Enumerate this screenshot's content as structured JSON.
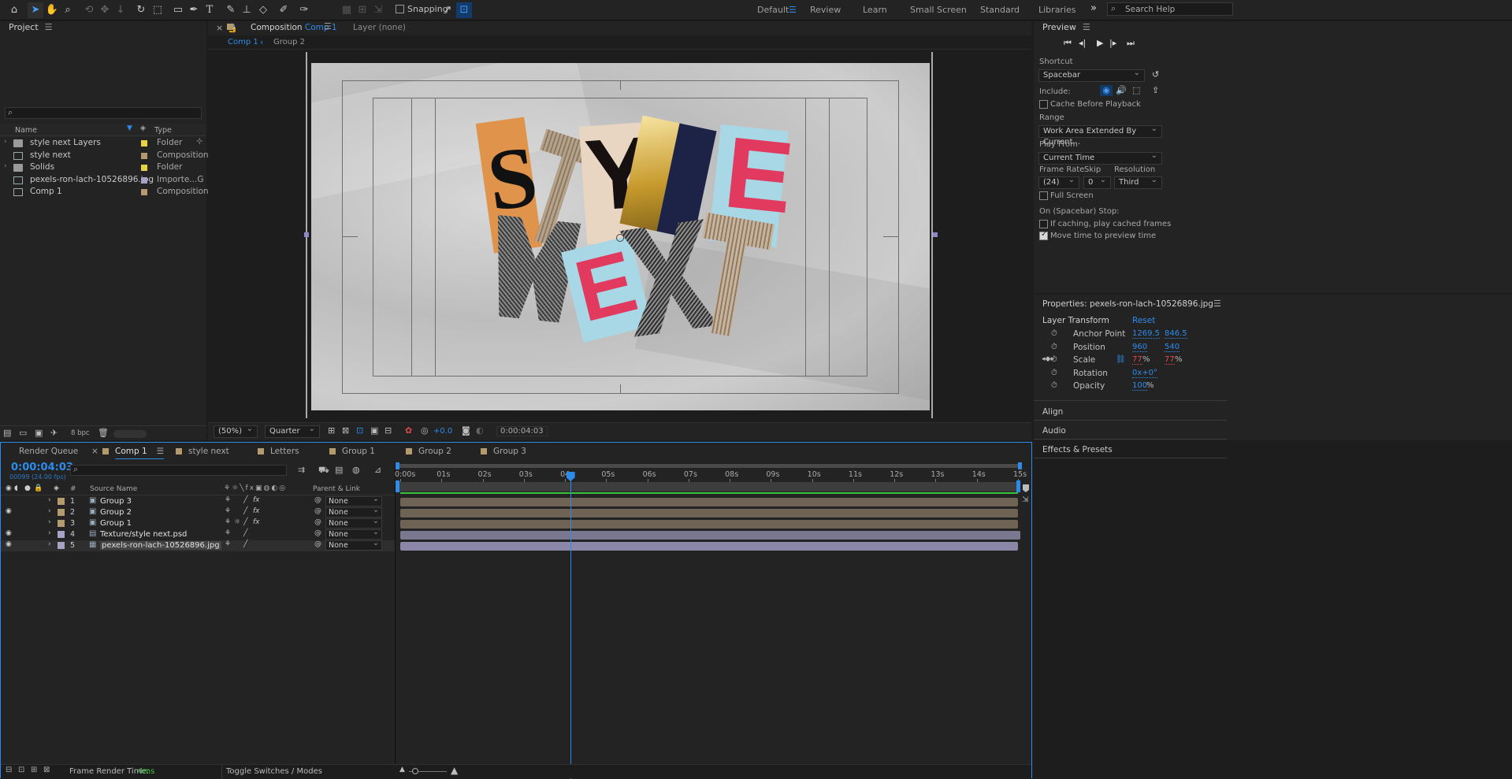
{
  "toolbar": {
    "snapping_label": "Snapping",
    "workspaces": [
      "Default",
      "Review",
      "Learn",
      "Small Screen",
      "Standard",
      "Libraries"
    ],
    "active_workspace": "Default",
    "overflow_icon": "chevrons-right-icon",
    "search_placeholder": "Search Help"
  },
  "project": {
    "title": "Project",
    "columns": {
      "name": "Name",
      "type": "Type"
    },
    "items": [
      {
        "name": "style next Layers",
        "type": "Folder",
        "color": "#e8d440",
        "icon": "folder-icon"
      },
      {
        "name": "style next",
        "type": "Composition",
        "color": "#b59a6e",
        "icon": "folder-icon"
      },
      {
        "name": "Solids",
        "type": "Folder",
        "color": "#e8d440",
        "icon": "folder-icon"
      },
      {
        "name": "pexels-ron-lach-10526896.jpg",
        "type": "Importe...G",
        "color": "#a6a2c6",
        "icon": "image-file-icon"
      },
      {
        "name": "Comp 1",
        "type": "Composition",
        "color": "#b59a6e",
        "icon": "composition-icon"
      }
    ],
    "bpc": "8 bpc"
  },
  "composition": {
    "tab_prefix": "Composition",
    "tab_name": "Comp 1",
    "layer_label": "Layer (none)",
    "breadcrumbs": [
      "Comp 1",
      "Group 2"
    ],
    "zoom": "(50%)",
    "resolution": "Quarter",
    "exposure": "+0.0",
    "timecode": "0:00:04:03"
  },
  "preview": {
    "title": "Preview",
    "shortcut_label": "Shortcut",
    "shortcut_value": "Spacebar",
    "include_label": "Include:",
    "cache_before_playback": "Cache Before Playback",
    "range_label": "Range",
    "range_value": "Work Area Extended By Current...",
    "play_from_label": "Play From",
    "play_from_value": "Current Time",
    "frame_rate_label": "Frame Rate",
    "skip_label": "Skip",
    "resolution_label": "Resolution",
    "frame_rate_value": "(24)",
    "skip_value": "0",
    "resolution_value": "Third",
    "full_screen": "Full Screen",
    "stop_label": "On (Spacebar) Stop:",
    "if_caching": "If caching, play cached frames",
    "move_time": "Move time to preview time"
  },
  "properties": {
    "title": "Properties: pexels-ron-lach-10526896.jpg",
    "section": "Layer Transform",
    "reset": "Reset",
    "rows": [
      {
        "label": "Anchor Point",
        "v1": "1269.5",
        "v2": "846.5"
      },
      {
        "label": "Position",
        "v1": "960",
        "v2": "540"
      },
      {
        "label": "Scale",
        "v1": "77",
        "v2": "77",
        "unit": "%"
      },
      {
        "label": "Rotation",
        "v1": "0x+0°"
      },
      {
        "label": "Opacity",
        "v1": "100",
        "unit": "%"
      }
    ],
    "sections": [
      "Align",
      "Audio",
      "Effects & Presets"
    ]
  },
  "timeline": {
    "tabs": [
      {
        "label": "Render Queue",
        "color": ""
      },
      {
        "label": "Comp 1",
        "color": "#b59a6e"
      },
      {
        "label": "style next",
        "color": "#b59a6e"
      },
      {
        "label": "Letters",
        "color": "#b59a6e"
      },
      {
        "label": "Group 1",
        "color": "#b59a6e"
      },
      {
        "label": "Group 2",
        "color": "#b59a6e"
      },
      {
        "label": "Group 3",
        "color": "#b59a6e"
      }
    ],
    "timecode": "0:00:04:03",
    "frame_info": "00099 (24.00 fps)",
    "col_source": "Source Name",
    "col_num": "#",
    "col_parent": "Parent & Link",
    "ruler": [
      "0:00s",
      "01s",
      "02s",
      "03s",
      "04s",
      "05s",
      "06s",
      "07s",
      "08s",
      "09s",
      "10s",
      "11s",
      "12s",
      "13s",
      "14s",
      "15s"
    ],
    "playhead_seconds": 4.125,
    "layers": [
      {
        "num": "1",
        "name": "Group 3",
        "color": "#b59a6e",
        "parent": "None",
        "type": "comp",
        "fx": true
      },
      {
        "num": "2",
        "name": "Group 2",
        "color": "#b59a6e",
        "parent": "None",
        "type": "comp",
        "fx": true
      },
      {
        "num": "3",
        "name": "Group 1",
        "color": "#b59a6e",
        "parent": "None",
        "type": "comp",
        "fx": true
      },
      {
        "num": "4",
        "name": "Texture/style next.psd",
        "color": "#a6a2c6",
        "parent": "None",
        "type": "psd",
        "fx": false
      },
      {
        "num": "5",
        "name": "pexels-ron-lach-10526896.jpg",
        "color": "#a6a2c6",
        "parent": "None",
        "type": "image",
        "fx": false
      }
    ],
    "frame_render_label": "Frame Render Time:",
    "frame_render_value": "4ms",
    "toggle_label": "Toggle Switches / Modes"
  },
  "canvas": {
    "artwork_letters": [
      "S",
      "T",
      "Y",
      "L",
      "E",
      "N",
      "E",
      "X",
      "T"
    ]
  }
}
